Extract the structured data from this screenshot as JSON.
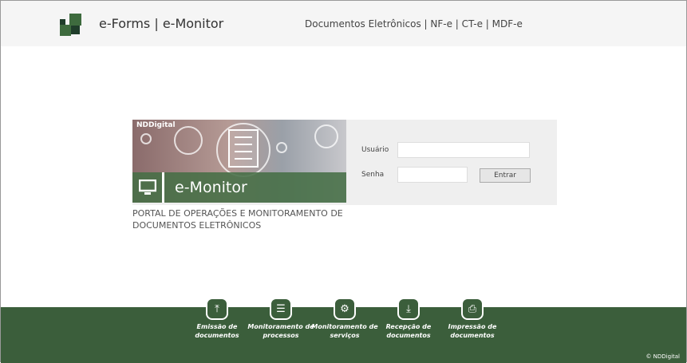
{
  "header": {
    "title": "e-Forms | e-Monitor",
    "nav": "Documentos Eletrônicos | NF-e | CT-e | MDF-e"
  },
  "banner": {
    "brand": "NDDigital",
    "product": "e-Monitor",
    "subtitle": "PORTAL DE OPERAÇÕES E MONITORAMENTO DE DOCUMENTOS ELETRÔNICOS"
  },
  "login": {
    "user_label": "Usuário",
    "user_value": "",
    "password_label": "Senha",
    "password_value": "",
    "submit": "Entrar"
  },
  "footer": {
    "items": [
      {
        "icon": "upload-icon",
        "glyph": "⤒",
        "label": "Emissão de documentos"
      },
      {
        "icon": "sliders-icon",
        "glyph": "☰",
        "label": "Monitoramento de processos"
      },
      {
        "icon": "gears-icon",
        "glyph": "⚙",
        "label": "Monitoramento de serviços"
      },
      {
        "icon": "download-icon",
        "glyph": "⤓",
        "label": "Recepção de documentos"
      },
      {
        "icon": "printer-icon",
        "glyph": "⎙",
        "label": "Impressão de documentos"
      }
    ],
    "copyright": "© NDDigital"
  },
  "colors": {
    "brand_green": "#3b5e3b",
    "banner_green": "#466e46"
  }
}
